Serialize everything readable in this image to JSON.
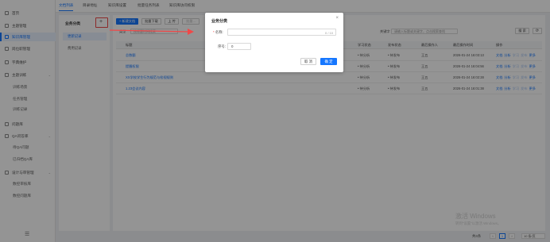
{
  "sidebar": {
    "items": [
      {
        "label": "首页",
        "icon": "home-icon",
        "sub": false,
        "active": false,
        "caret": false
      },
      {
        "label": "主题管理",
        "icon": "topic-icon",
        "sub": false,
        "active": false,
        "caret": false
      },
      {
        "label": "知识库管理",
        "icon": "knowledge-icon",
        "sub": false,
        "active": true,
        "caret": false
      },
      {
        "label": "岗位职管理",
        "icon": "position-icon",
        "sub": false,
        "active": false,
        "caret": false
      },
      {
        "label": "字典维护",
        "icon": "dictionary-icon",
        "sub": false,
        "active": false,
        "caret": false
      },
      {
        "label": "主题训练",
        "icon": "training-icon",
        "sub": false,
        "active": false,
        "caret": true
      },
      {
        "label": "训练场景",
        "icon": "",
        "sub": true,
        "active": false,
        "caret": false
      },
      {
        "label": "任务管理",
        "icon": "",
        "sub": true,
        "active": false,
        "caret": false
      },
      {
        "label": "训练记录",
        "icon": "",
        "sub": true,
        "active": false,
        "caret": false
      },
      {
        "label": "问题库",
        "icon": "question-bank-icon",
        "sub": false,
        "active": false,
        "caret": false
      },
      {
        "label": "QA问答库",
        "icon": "qa-icon",
        "sub": false,
        "active": false,
        "caret": true
      },
      {
        "label": "待QA问题",
        "icon": "",
        "sub": true,
        "active": false,
        "caret": false
      },
      {
        "label": "已归档QA库",
        "icon": "",
        "sub": true,
        "active": false,
        "caret": false
      },
      {
        "label": "设计与审管理",
        "icon": "design-icon",
        "sub": false,
        "active": false,
        "caret": true
      },
      {
        "label": "数控审核库",
        "icon": "",
        "sub": true,
        "active": false,
        "caret": false
      },
      {
        "label": "数控问题库",
        "icon": "",
        "sub": true,
        "active": false,
        "caret": false
      }
    ],
    "collapse_icon": "hamburger-icon"
  },
  "tabs": [
    {
      "label": "文档列表",
      "active": true
    },
    {
      "label": "目录地址",
      "active": false
    },
    {
      "label": "知识库设置",
      "active": false
    },
    {
      "label": "批量任务列表",
      "active": false
    },
    {
      "label": "知识库访问权限",
      "active": false
    }
  ],
  "category_panel": {
    "title": "业务分类",
    "add_label": "+",
    "items": [
      {
        "label": "更新记录",
        "selected": true
      },
      {
        "label": "费用记录",
        "selected": false
      }
    ]
  },
  "toolbar": {
    "new_doc": "+ 新建文档",
    "batch_download": "批量下载",
    "upload": "上 传",
    "disabled_btn": "批量...",
    "category_label": "类型",
    "category_value": "按标题时间搜索",
    "keyword_label": "关键字",
    "keyword_placeholder": "请输入标题或关键字，点击搜索查找",
    "search_btn": "搜 索",
    "refresh_icon": "refresh-icon"
  },
  "table": {
    "columns": [
      "标题",
      "学习状态",
      "发布状态",
      "最后操作人",
      "最后操作时间",
      "操作"
    ],
    "rows": [
      {
        "title": "总数额",
        "learn": "• 待分析",
        "publish": "• 待发布",
        "operator": "王五",
        "time": "2026-01-24 16:03:13"
      },
      {
        "title": "提醒权限",
        "learn": "• 待分析",
        "publish": "• 待发布",
        "operator": "王五",
        "time": "2026-01-24 16:04:56"
      },
      {
        "title": "XX学校学生行为规范与检视规则",
        "learn": "• 待分析",
        "publish": "• 待发布",
        "operator": "王五",
        "time": "2026-01-24 16:02:28"
      },
      {
        "title": "1.23会议内容",
        "learn": "• 待分析",
        "publish": "• 待发布",
        "operator": "王五",
        "time": "2026-01-24 16:01:38"
      }
    ],
    "ops": [
      "文档",
      "分析",
      "学习",
      "发布",
      "更多"
    ]
  },
  "pagination": {
    "total": "共4条",
    "prev": "‹",
    "page": "1",
    "next": "›",
    "page_size": "10 条/页"
  },
  "watermark": {
    "line1": "激活 Windows",
    "line2": "转到\"设置\"以激活 Windows。"
  },
  "dialog": {
    "title": "业务分类",
    "close": "×",
    "name_label": "名称:",
    "name_required": "*",
    "name_value": "",
    "name_count": "0 / 10",
    "order_label": "序号:",
    "order_value": "0",
    "cancel": "取 消",
    "confirm": "确 定"
  },
  "colors": {
    "accent": "#1677ff",
    "annotation": "#f04848"
  }
}
